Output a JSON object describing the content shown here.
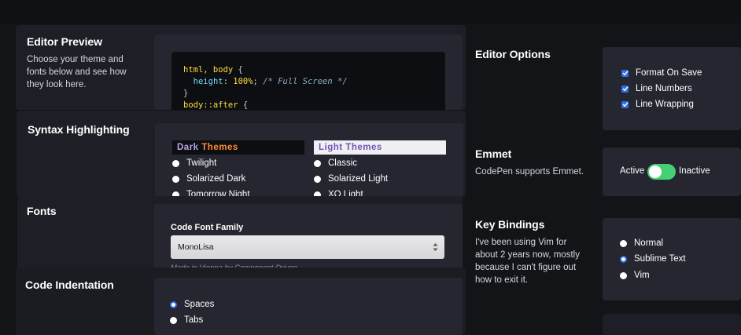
{
  "editor_preview": {
    "title": "Editor Preview",
    "description": "Choose your theme and fonts below and see how they look here.",
    "code": {
      "line1_selector": "html, body",
      "line1_brace": " {",
      "line2_prop": "height",
      "line2_colon": ": ",
      "line2_value": "100%",
      "line2_semi": "; ",
      "line2_comment": "/* Full Screen */",
      "line3": "}",
      "line4_selector": "body::after",
      "line4_brace": " {"
    }
  },
  "syntax_highlighting": {
    "title": "Syntax Highlighting",
    "dark_head_word1": "Dark",
    "dark_head_word2": "Themes",
    "light_head": "Light Themes",
    "dark_themes": [
      "Twilight",
      "Solarized Dark",
      "Tomorrow Night"
    ],
    "light_themes": [
      "Classic",
      "Solarized Light",
      "XQ Light"
    ]
  },
  "fonts": {
    "title": "Fonts",
    "field_label": "Code Font Family",
    "selected": "MonoLisa",
    "hint": "Made in Vienna by Component-Driven"
  },
  "code_indentation": {
    "title": "Code Indentation",
    "options": [
      "Spaces",
      "Tabs"
    ],
    "selected": "Spaces"
  },
  "editor_options": {
    "title": "Editor Options",
    "checkboxes": [
      "Format On Save",
      "Line Numbers",
      "Line Wrapping"
    ]
  },
  "emmet": {
    "title": "Emmet",
    "description": "CodePen supports Emmet.",
    "toggle_left": "Active",
    "toggle_right": "Inactive"
  },
  "key_bindings": {
    "title": "Key Bindings",
    "description": "I've been using Vim for about 2 years now, mostly because I can't figure out how to exit it.",
    "options": [
      "Normal",
      "Sublime Text",
      "Vim"
    ],
    "selected": "Sublime Text"
  },
  "colors": {
    "accent_blue": "#2f6fe4",
    "toggle_green": "#47cf73",
    "dark_theme_bg": "#0d0e11",
    "light_theme_bg": "#f0f0f4",
    "dark_label_orange": "#ff8c33",
    "light_label_purple": "#7353b6"
  }
}
